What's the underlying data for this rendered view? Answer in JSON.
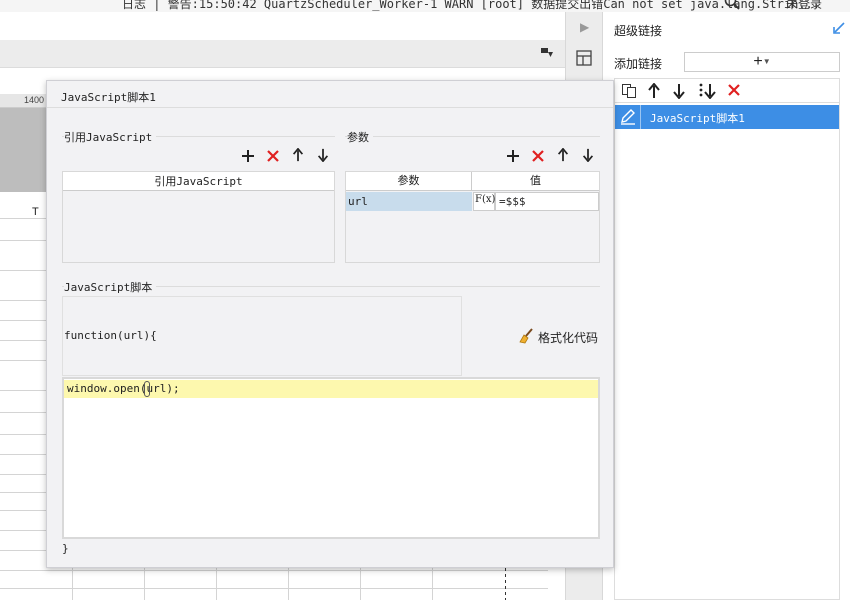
{
  "topbar": {
    "log_text": "日志 | 警告:15:50:42 QuartzScheduler_Worker-1 WARN [root] 数据提交出错Can not set java.lang.Strin...",
    "login": "未登录"
  },
  "background": {
    "ruler_label": "1400",
    "cell_text": "T"
  },
  "right_panel": {
    "title": "超级链接",
    "add_label": "添加链接",
    "add_button_symbol": "+",
    "list_items": [
      {
        "label": "JavaScript脚本1",
        "selected": true
      }
    ]
  },
  "dialog": {
    "title": "JavaScript脚本1",
    "ref_section": {
      "label": "引用JavaScript",
      "column_header": "引用JavaScript",
      "rows": []
    },
    "param_section": {
      "label": "参数",
      "columns": [
        "参数",
        "值"
      ],
      "rows": [
        {
          "name": "url",
          "fx": "F(x)",
          "value": "=$$$"
        }
      ]
    },
    "script_section": {
      "label": "JavaScript脚本",
      "function_header": "function(url){",
      "format_button": "格式化代码",
      "code_line": "window.open(url);",
      "function_footer": "}"
    }
  },
  "colors": {
    "accent": "#3d8ee5",
    "delete_red": "#e02020",
    "highlight_line": "#fdf8ae",
    "param_selected": "#c8dcec"
  }
}
